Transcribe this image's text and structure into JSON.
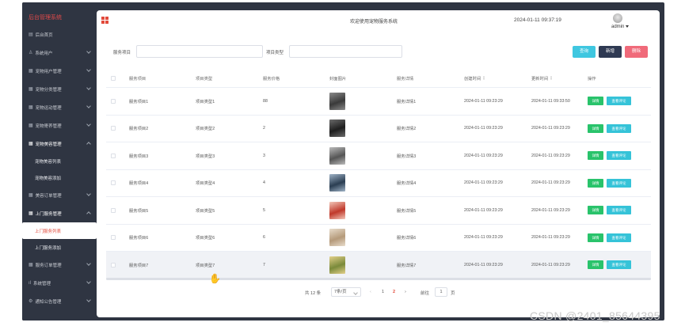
{
  "sidebar": {
    "title": "后台管理系统",
    "items": [
      {
        "label": "后台首页",
        "icon": "home-icon",
        "expandable": false
      },
      {
        "label": "系统用户",
        "icon": "user-icon",
        "expandable": true
      },
      {
        "label": "宠物用户管理",
        "icon": "grid-icon",
        "expandable": true
      },
      {
        "label": "宠物分类管理",
        "icon": "grid-icon",
        "expandable": true
      },
      {
        "label": "宠物运动管理",
        "icon": "grid-icon",
        "expandable": true
      },
      {
        "label": "宠物寄养管理",
        "icon": "grid-icon",
        "expandable": true
      },
      {
        "label": "宠物美容管理",
        "icon": "grid-icon",
        "expandable": true,
        "open": true,
        "children": [
          "宠物美容列表",
          "宠物美容添加"
        ]
      },
      {
        "label": "美容订单管理",
        "icon": "grid-icon",
        "expandable": true
      },
      {
        "label": "上门服务管理",
        "icon": "grid-icon",
        "expandable": true,
        "open": true,
        "children": [
          "上门服务列表",
          "上门服务添加"
        ],
        "active_child": 0
      },
      {
        "label": "服务订单管理",
        "icon": "grid-icon",
        "expandable": true
      },
      {
        "label": "系统管理",
        "icon": "chart-icon",
        "expandable": true
      },
      {
        "label": "通知公告管理",
        "icon": "settings-icon",
        "expandable": true
      }
    ]
  },
  "header": {
    "welcome": "欢迎使用宠物服务系统",
    "datetime": "2024-01-11 09:37:19",
    "user": "admin"
  },
  "search": {
    "field1_label": "服务项目",
    "field1_value": "",
    "field2_label": "项目类型",
    "field2_value": "",
    "search_label": "查询",
    "add_label": "新增",
    "delete_label": "删除"
  },
  "table": {
    "columns": [
      "服务项目",
      "项目类型",
      "服务价格",
      "封面图片",
      "服务详情",
      "创建时间",
      "更新时间",
      "操作"
    ],
    "detail_label": "详情",
    "eval_label": "查看评论",
    "rows": [
      {
        "name": "服务项目1",
        "type": "项目类型1",
        "price": "88",
        "detail": "服务详情1",
        "created": "2024-01-11 09:23:29",
        "updated": "2024-01-11 09:33:50",
        "img": [
          "#3a3a3a",
          "#8a8a8a"
        ]
      },
      {
        "name": "服务项目2",
        "type": "项目类型2",
        "price": "2",
        "detail": "服务详情2",
        "created": "2024-01-11 09:23:29",
        "updated": "2024-01-11 09:23:29",
        "img": [
          "#1e1e1e",
          "#6b6b6b"
        ]
      },
      {
        "name": "服务项目3",
        "type": "项目类型3",
        "price": "3",
        "detail": "服务详情3",
        "created": "2024-01-11 09:23:29",
        "updated": "2024-01-11 09:23:29",
        "img": [
          "#555555",
          "#bbbbbb"
        ]
      },
      {
        "name": "服务项目4",
        "type": "项目类型4",
        "price": "4",
        "detail": "服务详情4",
        "created": "2024-01-11 09:23:29",
        "updated": "2024-01-11 09:23:29",
        "img": [
          "#2b3e52",
          "#9fb3c7"
        ]
      },
      {
        "name": "服务项目5",
        "type": "项目类型5",
        "price": "5",
        "detail": "服务详情5",
        "created": "2024-01-11 09:23:29",
        "updated": "2024-01-11 09:23:29",
        "img": [
          "#c0392b",
          "#f3c6b8"
        ]
      },
      {
        "name": "服务项目6",
        "type": "项目类型6",
        "price": "6",
        "detail": "服务详情6",
        "created": "2024-01-11 09:23:29",
        "updated": "2024-01-11 09:23:29",
        "img": [
          "#b59a7a",
          "#e8dccb"
        ]
      },
      {
        "name": "服务项目7",
        "type": "项目类型7",
        "price": "7",
        "detail": "服务详情7",
        "created": "2024-01-11 09:23:29",
        "updated": "2024-01-11 09:23:29",
        "img": [
          "#7a8a3a",
          "#e3d08a"
        ]
      }
    ]
  },
  "pagination": {
    "total": "共 12 条",
    "page_size": "7条/页",
    "pages": [
      "1",
      "2"
    ],
    "current": "2",
    "goto_label": "前往",
    "goto_value": "1",
    "page_suffix": "页"
  },
  "watermark": "CSDN @2401_85644395",
  "colors": {
    "sidebar_bg": "#2f3542",
    "accent": "#e24a3b",
    "search_btn": "#3fc7e0",
    "add_btn": "#2f3a53",
    "delete_btn": "#f06a7a",
    "detail_btn": "#29c36b",
    "eval_btn": "#35c3d8"
  }
}
